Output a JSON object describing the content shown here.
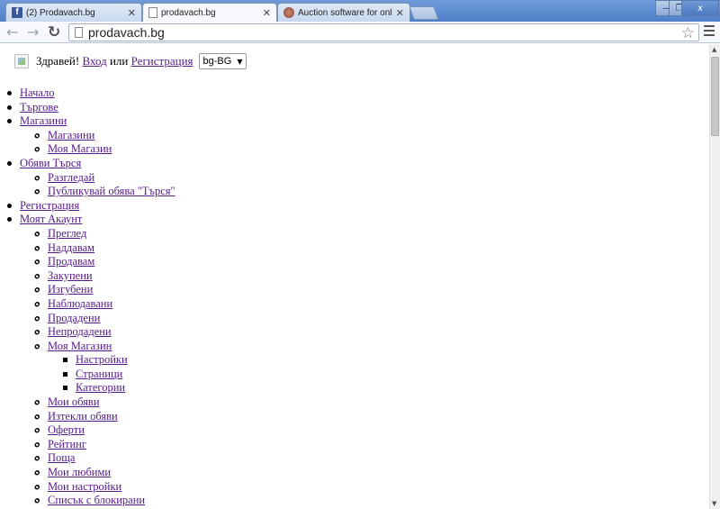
{
  "browser": {
    "tabs": [
      {
        "label": "(2) Prodavach.bg",
        "icon": "facebook-icon",
        "active": false
      },
      {
        "label": "prodavach.bg",
        "icon": "page-icon",
        "active": true
      },
      {
        "label": "Auction software for online a",
        "icon": "auction-icon",
        "active": false
      }
    ],
    "url": "prodavach.bg",
    "window_buttons": {
      "minimize": "—",
      "maximize": "❐",
      "close": "x"
    }
  },
  "header": {
    "greeting": "Здравей! ",
    "login_label": "Вход",
    "or_text": " или ",
    "register_label": "Регистрация",
    "language": "bg-BG"
  },
  "menu": [
    {
      "label": "Начало"
    },
    {
      "label": "Търгове"
    },
    {
      "label": "Магазини",
      "children": [
        {
          "label": "Магазини"
        },
        {
          "label": "Моя Магазин"
        }
      ]
    },
    {
      "label": "Обяви Търся",
      "children": [
        {
          "label": "Разгледай"
        },
        {
          "label": "Публикувай обява \"Търся\""
        }
      ]
    },
    {
      "label": "Регистрация"
    },
    {
      "label": "Моят Акаунт",
      "children": [
        {
          "label": "Преглед"
        },
        {
          "label": "Наддавам"
        },
        {
          "label": "Продавам"
        },
        {
          "label": "Закупени"
        },
        {
          "label": "Изгубени"
        },
        {
          "label": "Наблюдавани"
        },
        {
          "label": "Продадени"
        },
        {
          "label": "Непродадени"
        },
        {
          "label": "Моя Магазин",
          "children": [
            {
              "label": "Настройки"
            },
            {
              "label": "Страници"
            },
            {
              "label": "Категории"
            }
          ]
        },
        {
          "label": "Мои обяви"
        },
        {
          "label": "Изтекли обяви"
        },
        {
          "label": "Оферти"
        },
        {
          "label": "Рейтинг"
        },
        {
          "label": "Поща"
        },
        {
          "label": "Мои любими"
        },
        {
          "label": "Мои настройки"
        },
        {
          "label": "Списък с блокирани"
        }
      ]
    }
  ]
}
